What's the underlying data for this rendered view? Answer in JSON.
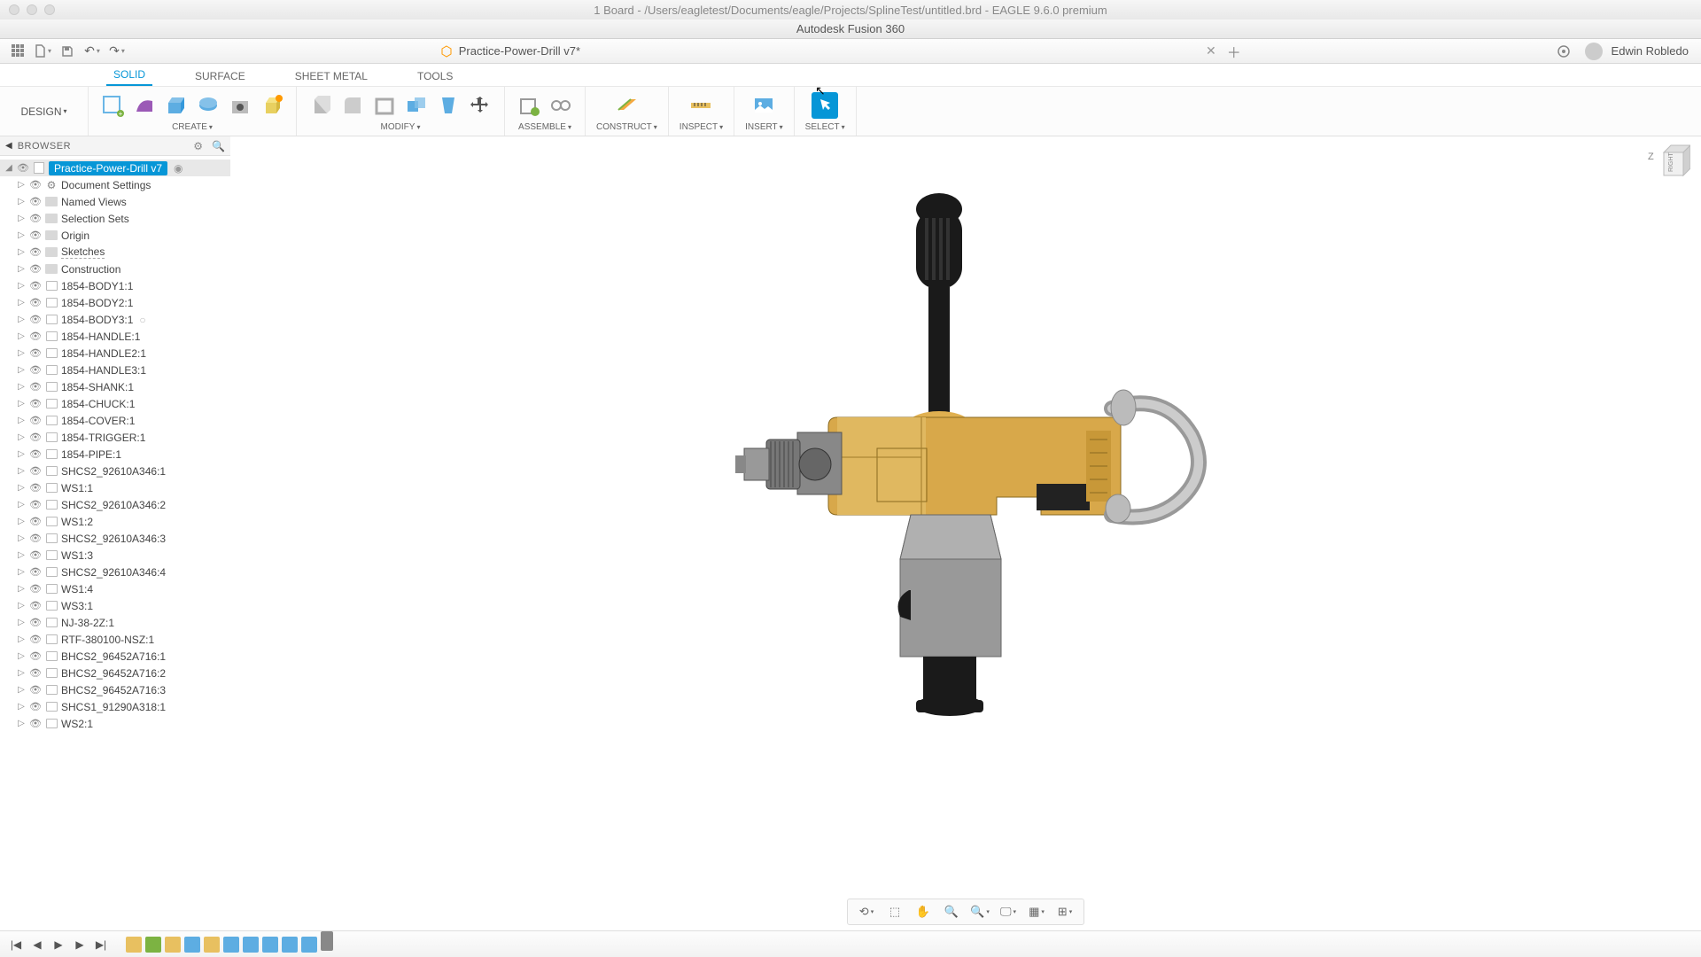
{
  "mac_title": "1 Board - /Users/eagletest/Documents/eagle/Projects/SplineTest/untitled.brd - EAGLE 9.6.0 premium",
  "app_title": "Autodesk Fusion 360",
  "doc_tab": "Practice-Power-Drill v7*",
  "username": "Edwin Robledo",
  "tabs": {
    "solid": "SOLID",
    "surface": "SURFACE",
    "sheetmetal": "SHEET METAL",
    "tools": "TOOLS"
  },
  "design_btn": "DESIGN",
  "groups": {
    "create": "CREATE",
    "modify": "MODIFY",
    "assemble": "ASSEMBLE",
    "construct": "CONSTRUCT",
    "inspect": "INSPECT",
    "insert": "INSERT",
    "select": "SELECT"
  },
  "browser": {
    "title": "BROWSER",
    "root": "Practice-Power-Drill v7",
    "folders": [
      "Document Settings",
      "Named Views",
      "Selection Sets",
      "Origin",
      "Sketches",
      "Construction"
    ],
    "components": [
      "1854-BODY1:1",
      "1854-BODY2:1",
      "1854-BODY3:1",
      "1854-HANDLE:1",
      "1854-HANDLE2:1",
      "1854-HANDLE3:1",
      "1854-SHANK:1",
      "1854-CHUCK:1",
      "1854-COVER:1",
      "1854-TRIGGER:1",
      "1854-PIPE:1",
      "SHCS2_92610A346:1",
      "WS1:1",
      "SHCS2_92610A346:2",
      "WS1:2",
      "SHCS2_92610A346:3",
      "WS1:3",
      "SHCS2_92610A346:4",
      "WS1:4",
      "WS3:1",
      "NJ-38-2Z:1",
      "RTF-380100-NSZ:1",
      "BHCS2_96452A716:1",
      "BHCS2_96452A716:2",
      "BHCS2_96452A716:3",
      "SHCS1_91290A318:1",
      "WS2:1"
    ]
  },
  "viewcube_z": "Z"
}
